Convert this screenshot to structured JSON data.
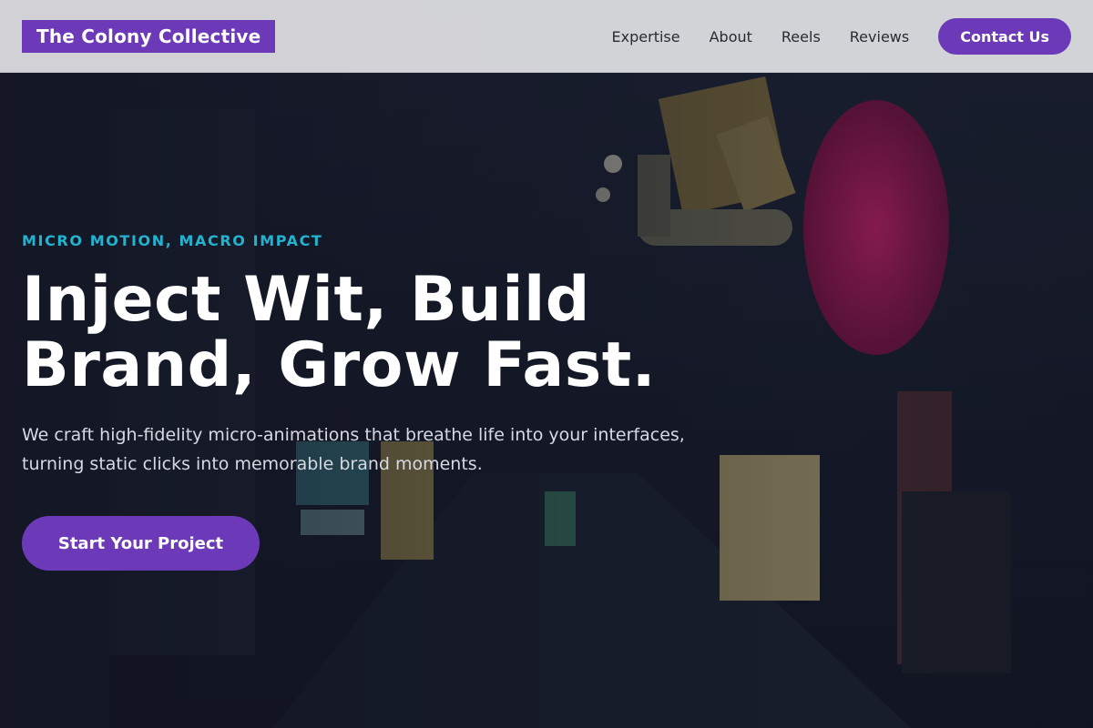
{
  "brand": {
    "name": "The Colony Collective",
    "color": "#6c3ab8"
  },
  "nav": {
    "links": [
      "Expertise",
      "About",
      "Reels",
      "Reviews"
    ],
    "contact_label": "Contact Us"
  },
  "hero": {
    "eyebrow": "MICRO MOTION, MACRO IMPACT",
    "headline_line1": "Inject Wit, Build",
    "headline_line2": "Brand, Grow Fast.",
    "subhead_line1": "We craft high-fidelity micro-animations that breathe life into your interfaces,",
    "subhead_line2": "turning static clicks into memorable brand moments.",
    "cta_label": "Start Your Project"
  },
  "colors": {
    "accent": "#6c3ab8",
    "eyebrow": "#22b3d1"
  }
}
